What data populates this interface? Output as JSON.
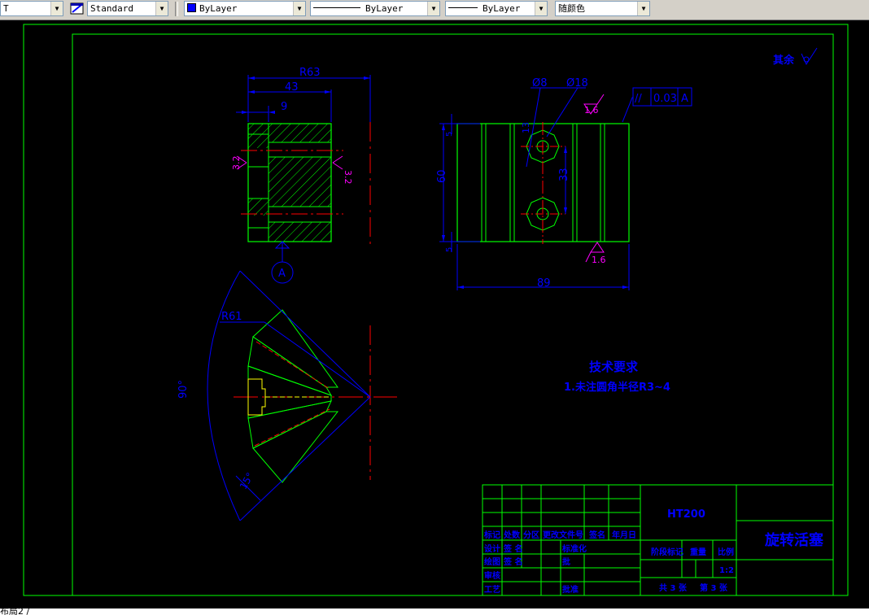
{
  "toolbar": {
    "font_style_value": "T",
    "dim_style_value": "Standard",
    "layer_color_value": "ByLayer",
    "linetype_value": "ByLayer",
    "lineweight_value": "ByLayer",
    "plot_color_value": "随颜色",
    "accent_color": "#0000ff"
  },
  "drawing": {
    "dim_r63": "R63",
    "dim_43": "43",
    "dim_9": "9",
    "rough_left": "3.2",
    "rough_right": "3.2",
    "datum_label": "A",
    "dim_d8": "Ø8",
    "dim_d18": "Ø18",
    "tol_symbol": "//",
    "tol_value": "0.03",
    "tol_datum": "A",
    "rough_top": "1.6",
    "rough_bottom": "1.6",
    "dim_13": "13",
    "dim_60": "60",
    "dim_33": "33",
    "dim_5_top": "5",
    "dim_5_bottom": "5",
    "dim_89": "89",
    "dim_r61": "R61",
    "dim_angle": "90°",
    "dim_15": "15°",
    "rest_label": "其余",
    "tech_title": "技术要求",
    "tech_note": "1.未注圆角半径R3~4"
  },
  "title_block": {
    "material": "HT200",
    "part_name": "旋转活塞",
    "hdr_mark": "标记",
    "hdr_count": "处数",
    "hdr_zone": "分区",
    "hdr_docno": "更改文件号",
    "hdr_sign": "签名",
    "hdr_date": "年月日",
    "row_design": "设计",
    "row_design_sign": "签 名",
    "row_std": "标准化",
    "row_draw": "绘图",
    "row_draw_sign": "签 名",
    "row_check": "审核",
    "row_process": "工艺",
    "row_approve": "批准",
    "row_unknown": "批",
    "stage_mark": "阶段标记",
    "weight": "重量",
    "scale": "比例",
    "scale_value": "1:2",
    "sheets_total": "共 3 张",
    "sheet_no": "第 3 张"
  },
  "status_text": "布局2 /"
}
